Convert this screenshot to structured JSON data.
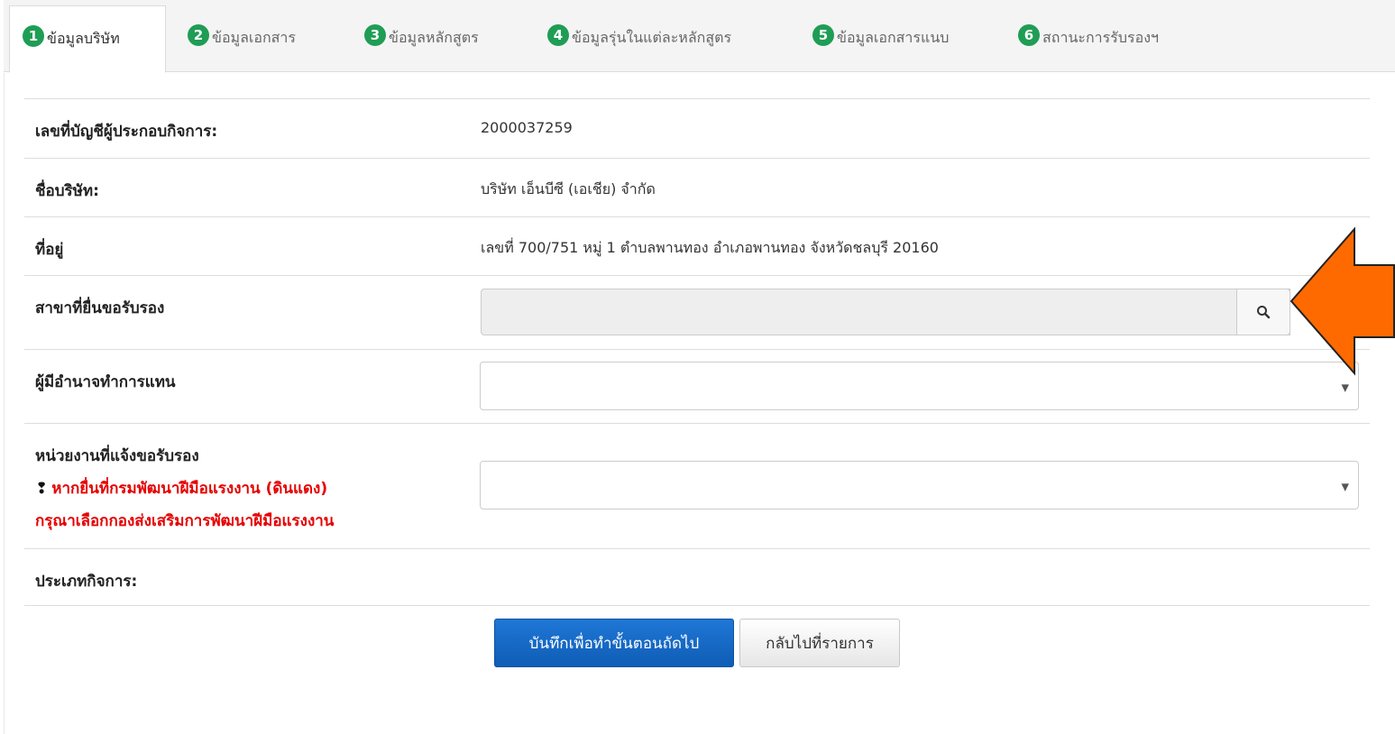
{
  "tabs": [
    {
      "num": "1",
      "label": "ข้อมูลบริษัท"
    },
    {
      "num": "2",
      "label": "ข้อมูลเอกสาร"
    },
    {
      "num": "3",
      "label": "ข้อมูลหลักสูตร"
    },
    {
      "num": "4",
      "label": "ข้อมูลรุ่นในแต่ละหลักสูตร"
    },
    {
      "num": "5",
      "label": "ข้อมูลเอกสารแนบ"
    },
    {
      "num": "6",
      "label": "สถานะการรับรองฯ"
    }
  ],
  "active_tab": "1",
  "form": {
    "account_label": "เลขที่บัญชีผู้ประกอบกิจการ:",
    "account_value": "2000037259",
    "company_label": "ชื่อบริษัท:",
    "company_value": "บริษัท เอ็นบีซี (เอเชีย) จำกัด",
    "address_label": "ที่อยู่",
    "address_value": "เลขที่ 700/751 หมู่ 1 ตำบลพานทอง อำเภอพานทอง จังหวัดชลบุรี 20160",
    "branch_label": "สาขาที่ยื่นขอรับรอง",
    "branch_value": "",
    "authorized_label": "ผู้มีอำนาจทำการแทน",
    "authorized_value": "",
    "agency_label": "หน่วยงานที่แจ้งขอรับรอง",
    "agency_warning_line1": "หากยื่นที่กรมพัฒนาฝีมือแรงงาน (ดินแดง)",
    "agency_warning_line2": "กรุณาเลือกกองส่งเสริมการพัฒนาฝีมือแรงงาน",
    "agency_value": "",
    "business_type_label": "ประเภทกิจการ:",
    "business_type_value": ""
  },
  "buttons": {
    "save_next": "บันทึกเพื่อทำขั้นตอนถัดไป",
    "back_to_list": "กลับไปที่รายการ"
  },
  "colors": {
    "step_badge": "#1f9d55",
    "primary_button": "#0f5db5",
    "warning_text": "#e60000",
    "annotation_arrow": "#ff6a00"
  },
  "icons": {
    "search": "search-icon",
    "select_caret": "chevron-down-icon",
    "warning": "exclamation-icon",
    "annotation": "arrow-left-annotation"
  }
}
